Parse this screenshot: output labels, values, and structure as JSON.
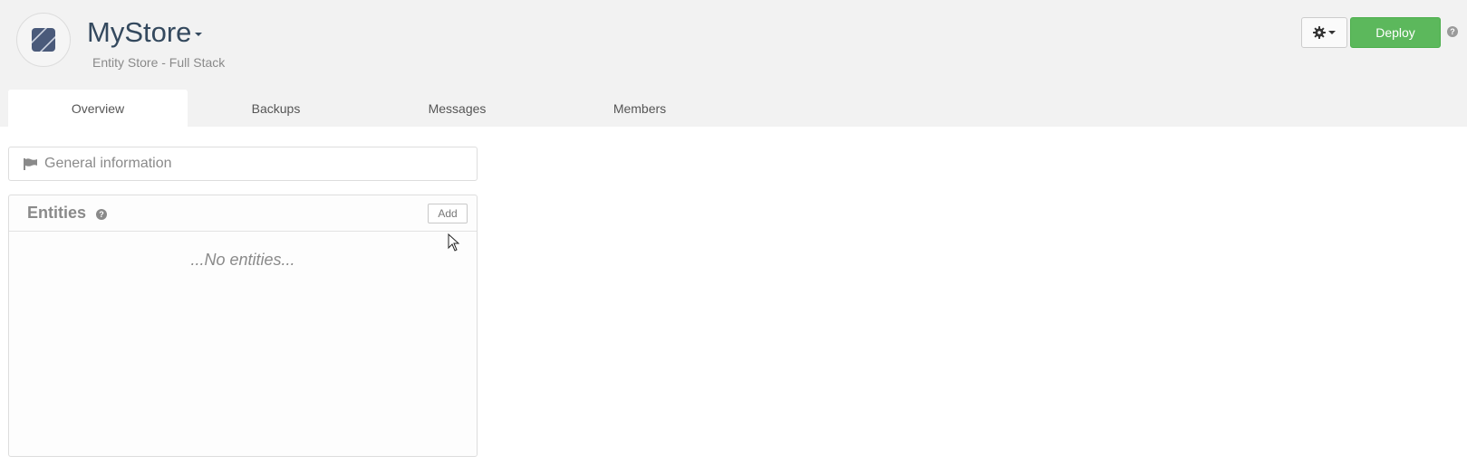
{
  "header": {
    "store_name": "MyStore",
    "subtitle": "Entity Store - Full Stack",
    "deploy_label": "Deploy",
    "settings_icon": "gear-icon",
    "help_icon": "question-circle-icon"
  },
  "tabs": [
    {
      "label": "Overview",
      "active": true
    },
    {
      "label": "Backups",
      "active": false
    },
    {
      "label": "Messages",
      "active": false
    },
    {
      "label": "Members",
      "active": false
    }
  ],
  "general": {
    "label": "General information",
    "icon": "flag-icon"
  },
  "entities": {
    "title": "Entities",
    "add_label": "Add",
    "empty_text": "...No entities..."
  },
  "colors": {
    "accent": "#5cb85c",
    "title": "#34495e",
    "header_bg": "#f2f2f2"
  }
}
